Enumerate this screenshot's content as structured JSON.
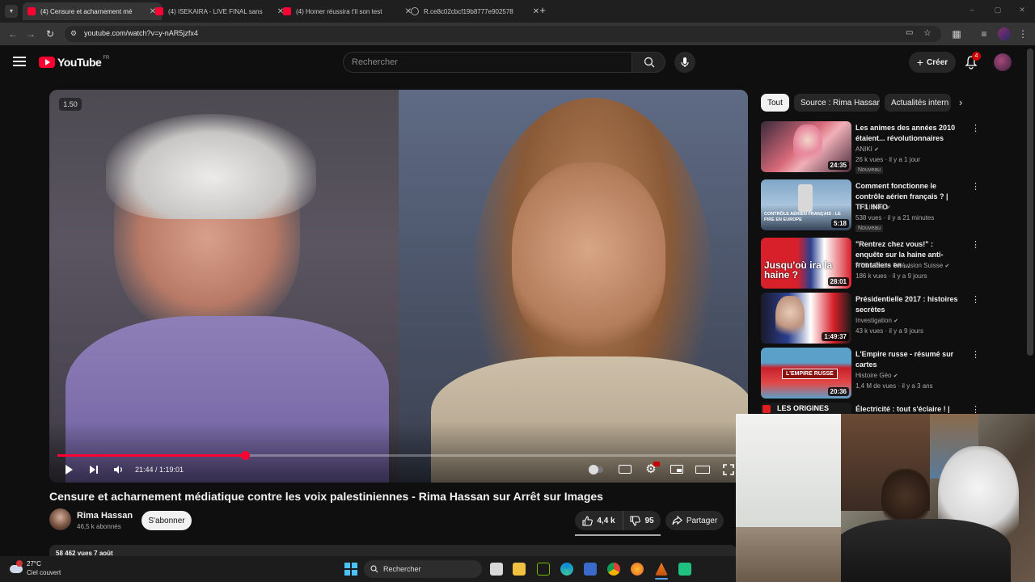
{
  "browser": {
    "tabs": [
      {
        "title": "(4) Censure et acharnement mé",
        "active": true
      },
      {
        "title": "(4) ISEKAIRA - LIVE FINAL sans",
        "active": false
      },
      {
        "title": "(4) Homer réussira t'il son test",
        "active": false
      },
      {
        "title": "R.ce8c02cbcf19b8777e902578",
        "active": false
      }
    ],
    "url": "youtube.com/watch?v=y-nAR5jzfx4"
  },
  "header": {
    "logo": "YouTube",
    "region": "FR",
    "search_placeholder": "Rechercher",
    "create_label": "Créer",
    "notifications": "4"
  },
  "player": {
    "speed_badge": "1.50",
    "current_time": "21:44",
    "duration": "1:19:01",
    "time_display": "21:44 / 1:19:01",
    "progress": 0.275
  },
  "video": {
    "title": "Censure et acharnement médiatique contre les voix palestiniennes - Rima Hassan sur Arrêt sur Images",
    "channel": "Rima Hassan",
    "subscribers": "46,5 k abonnés",
    "subscribe_label": "S'abonner",
    "likes": "4,4 k",
    "comments": "95",
    "share_label": "Partager",
    "description_preview": "58 462 vues  7 août"
  },
  "sidebar": {
    "chips": [
      "Tout",
      "Source : Rima Hassan",
      "Actualités intern"
    ],
    "recommendations": [
      {
        "title": "Les animes des années 2010 étaient... révolutionnaires",
        "channel": "ANIKI",
        "meta": "26 k vues · il y a 1 jour",
        "badge": "Nouveau",
        "duration": "24:35",
        "thumb_text": ""
      },
      {
        "title": "Comment fonctionne le contrôle aérien français ? | TF1 INFO",
        "channel": "TF1 INFO",
        "meta": "538 vues · il y a 21 minutes",
        "badge": "Nouveau",
        "duration": "5:18",
        "thumb_text": "CONTRÔLE AÉRIEN FRANÇAIS : LE PIRE EN EUROPE"
      },
      {
        "title": "\"Rentrez chez vous!\" : enquête sur la haine anti-frontaliers en ...",
        "channel": "RTS - Radio Télévision Suisse",
        "meta": "186 k vues · il y a 9 jours",
        "badge": "",
        "duration": "28:01",
        "thumb_text": "Jusqu'où ira la haine ?"
      },
      {
        "title": "Présidentielle 2017 : histoires secrètes",
        "channel": "Investigation",
        "meta": "43 k vues · il y a 9 jours",
        "badge": "",
        "duration": "1:49:37",
        "thumb_text": ""
      },
      {
        "title": "L'Empire russe - résumé sur cartes",
        "channel": "Histoire Géo",
        "meta": "1,4 M de vues · il y a 3 ans",
        "badge": "",
        "duration": "20:36",
        "thumb_text": "L'EMPIRE RUSSE"
      },
      {
        "title": "Électricité : tout s'éclaire ! |",
        "channel": "",
        "meta": "",
        "badge": "",
        "duration": "",
        "thumb_text": "LES ORIGINES"
      }
    ]
  },
  "taskbar": {
    "temperature": "27°C",
    "weather": "Ciel couvert",
    "search_label": "Rechercher"
  },
  "colors": {
    "accent": "#ff0033",
    "background": "#0f0f0f",
    "surface": "#272727"
  }
}
